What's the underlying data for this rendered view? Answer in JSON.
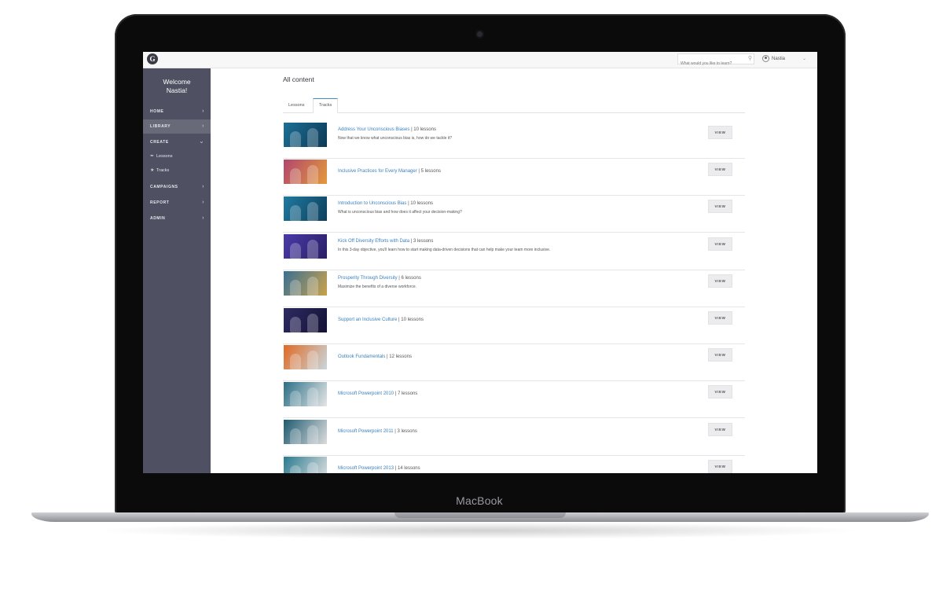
{
  "device": {
    "brand": "MacBook"
  },
  "topbar": {
    "logo_glyph": "G",
    "search_placeholder": "What would you like to learn?",
    "search_icon": "search-icon",
    "user_name": "Nastia",
    "user_icon": "user-avatar-icon"
  },
  "sidebar": {
    "welcome_line1": "Welcome",
    "welcome_line2": "Nastia!",
    "nav": [
      {
        "label": "HOME",
        "arrow": "›"
      },
      {
        "label": "LIBRARY",
        "arrow": "›"
      },
      {
        "label": "CREATE",
        "arrow": "⌄"
      },
      {
        "label": "CAMPAIGNS",
        "arrow": "›"
      },
      {
        "label": "REPORT",
        "arrow": "›"
      },
      {
        "label": "ADMIN",
        "arrow": "›"
      }
    ],
    "create_sub": [
      {
        "label": "Lessons",
        "icon": "pencil-icon"
      },
      {
        "label": "Tracks",
        "icon": "track-icon"
      }
    ]
  },
  "main": {
    "title": "All content",
    "tabs": [
      {
        "label": "Lessons"
      },
      {
        "label": "Tracks"
      }
    ],
    "active_tab": "Tracks",
    "view_label": "VIEW",
    "rows": [
      {
        "title": "Address Your Unconscious Biases",
        "count": "| 10 lessons",
        "desc": "Now that we know what unconscious bias is, how do we tackle it?",
        "thumb": [
          "#1d6f96",
          "#0d3a55"
        ]
      },
      {
        "title": "Inclusive Practices for Every Manager",
        "count": "| 5 lessons",
        "desc": "",
        "thumb": [
          "#b2456e",
          "#e39a3c"
        ]
      },
      {
        "title": "Introduction to Unconscious Bias",
        "count": "| 10 lessons",
        "desc": "What is unconscious bias and how does it affect your decision-making?",
        "thumb": [
          "#1f7aa0",
          "#0f3f5c"
        ]
      },
      {
        "title": "Kick Off Diversity Efforts with Data",
        "count": "| 3 lessons",
        "desc": "In this 3-day objective, you'll learn how to start making data-driven decisions that can help make your team more inclusive.",
        "thumb": [
          "#4a3aa8",
          "#2a1f66"
        ]
      },
      {
        "title": "Prosperity Through Diversity",
        "count": "| 6 lessons",
        "desc": "Maximize the benefits of a diverse workforce.",
        "thumb": [
          "#3a6f93",
          "#c9a24c"
        ]
      },
      {
        "title": "Support an Inclusive Culture",
        "count": "| 10 lessons",
        "desc": "",
        "thumb": [
          "#2e2a63",
          "#141235"
        ]
      },
      {
        "title": "Outlook Fundamentals",
        "count": "| 12 lessons",
        "desc": "",
        "thumb": [
          "#e06a24",
          "#c9d6dc"
        ]
      },
      {
        "title": "Microsoft Powerpoint 2010",
        "count": "| 7 lessons",
        "desc": "",
        "thumb": [
          "#2b6f86",
          "#e6e6e6"
        ]
      },
      {
        "title": "Microsoft Powerpoint 2011",
        "count": "| 3 lessons",
        "desc": "",
        "thumb": [
          "#1e5a70",
          "#dcdcdc"
        ]
      },
      {
        "title": "Microsoft Powerpoint 2013",
        "count": "| 14 lessons",
        "desc": "",
        "thumb": [
          "#2a7a90",
          "#e0e0e0"
        ]
      }
    ]
  }
}
